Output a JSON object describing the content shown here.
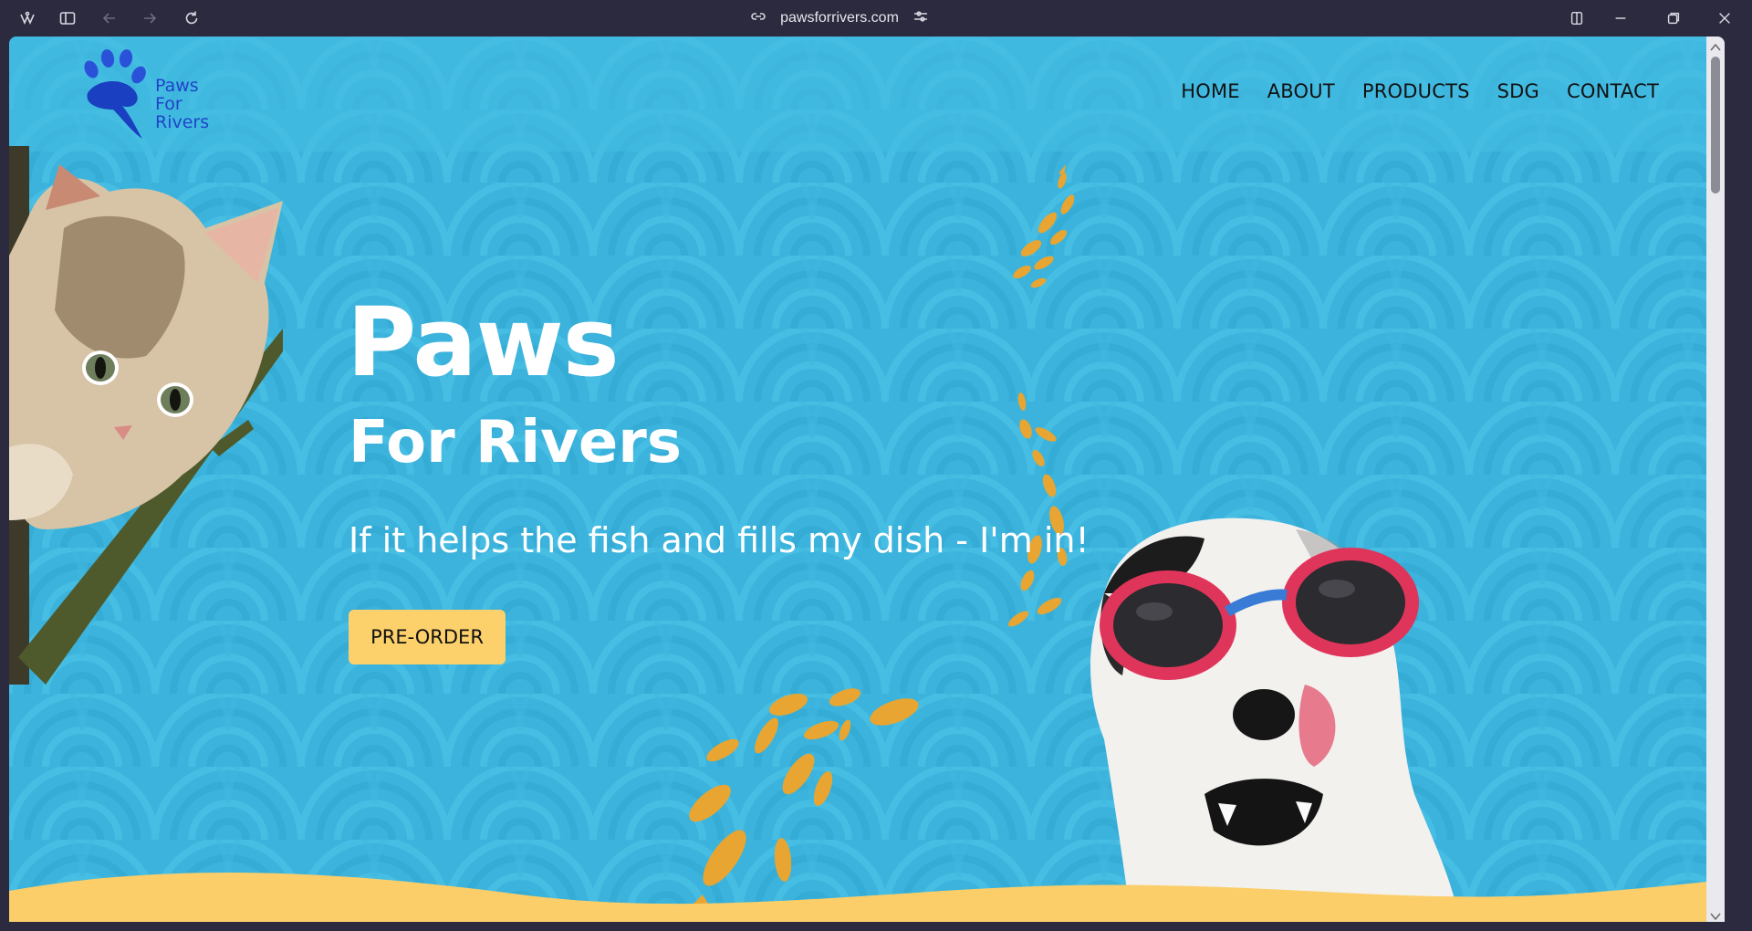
{
  "browser": {
    "url": "pawsforrivers.com",
    "icons": [
      "app-menu-icon",
      "sidebar-icon",
      "back-icon",
      "forward-icon",
      "reload-icon",
      "link-icon",
      "site-settings-icon",
      "split-view-icon",
      "minimize-icon",
      "restore-icon",
      "close-icon"
    ]
  },
  "site": {
    "logo": {
      "line1": "Paws",
      "line2": "For",
      "line3": "Rivers"
    },
    "nav": [
      "HOME",
      "ABOUT",
      "PRODUCTS",
      "SDG",
      "CONTACT"
    ],
    "hero": {
      "title": "Paws",
      "subtitle": "For Rivers",
      "tagline": "If it helps the fish and fills my dish - I'm in!",
      "cta": "PRE-ORDER"
    }
  },
  "colors": {
    "water": "#3bb3dc",
    "logo": "#1f44c8",
    "cta": "#fcd06a",
    "fish": "#e8a531",
    "sand": "#fcce6a"
  }
}
